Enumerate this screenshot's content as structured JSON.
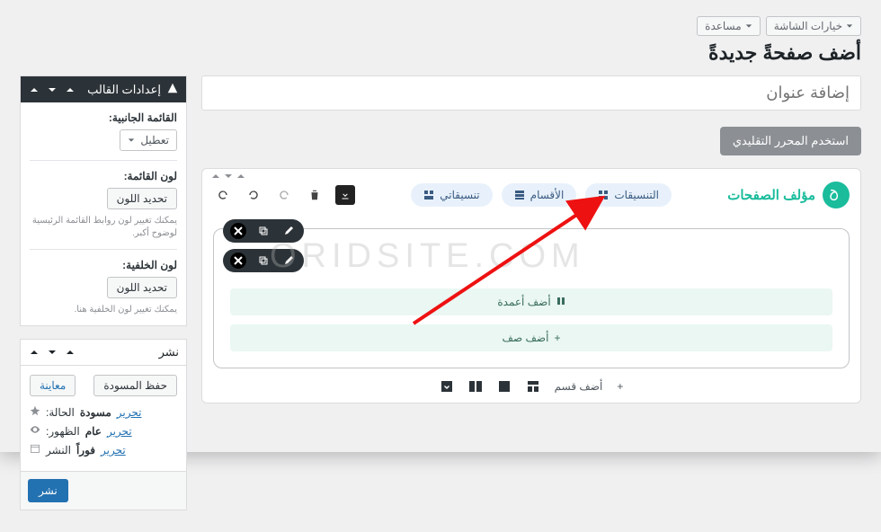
{
  "top": {
    "screen_options": "خيارات الشاشة",
    "help": "مساعدة"
  },
  "page_heading": "أضف صفحةً جديدةً",
  "title_placeholder": "إضافة عنوان",
  "classic_editor_btn": "استخدم المحرر التقليدي",
  "composer": {
    "brand": "مؤلف الصفحات",
    "pills": {
      "layouts": "التنسيقات",
      "sections": "الأقسام",
      "my_layouts": "تنسيقاتي"
    },
    "section_label": "section",
    "add_columns": "أضف أعمدة",
    "add_row": "أضف صف",
    "add_section": "أضف قسم"
  },
  "theme_box": {
    "title": "إعدادات القالب",
    "sidebar_label": "القائمة الجانبية:",
    "sidebar_value": "تعطيل",
    "menu_color_label": "لون القائمة:",
    "color_btn": "تحديد اللون",
    "menu_hint": "يمكنك تغيير لون روابط القائمة الرئيسية لوضوح أكبر.",
    "bg_color_label": "لون الخلفية:",
    "bg_hint": "يمكنك تغيير لون الخلفية هنا."
  },
  "publish_box": {
    "title": "نشر",
    "save_draft": "حفظ المسودة",
    "preview": "معاينة",
    "status_label": "الحالة:",
    "status_value": "مسودة",
    "visibility_label": "الظهور:",
    "visibility_value": "عام",
    "publish_on_label": "النشر",
    "publish_on_value": "فوراً",
    "edit": "تحرير",
    "publish_btn": "نشر"
  },
  "watermark": "ORIDSITE.COM"
}
